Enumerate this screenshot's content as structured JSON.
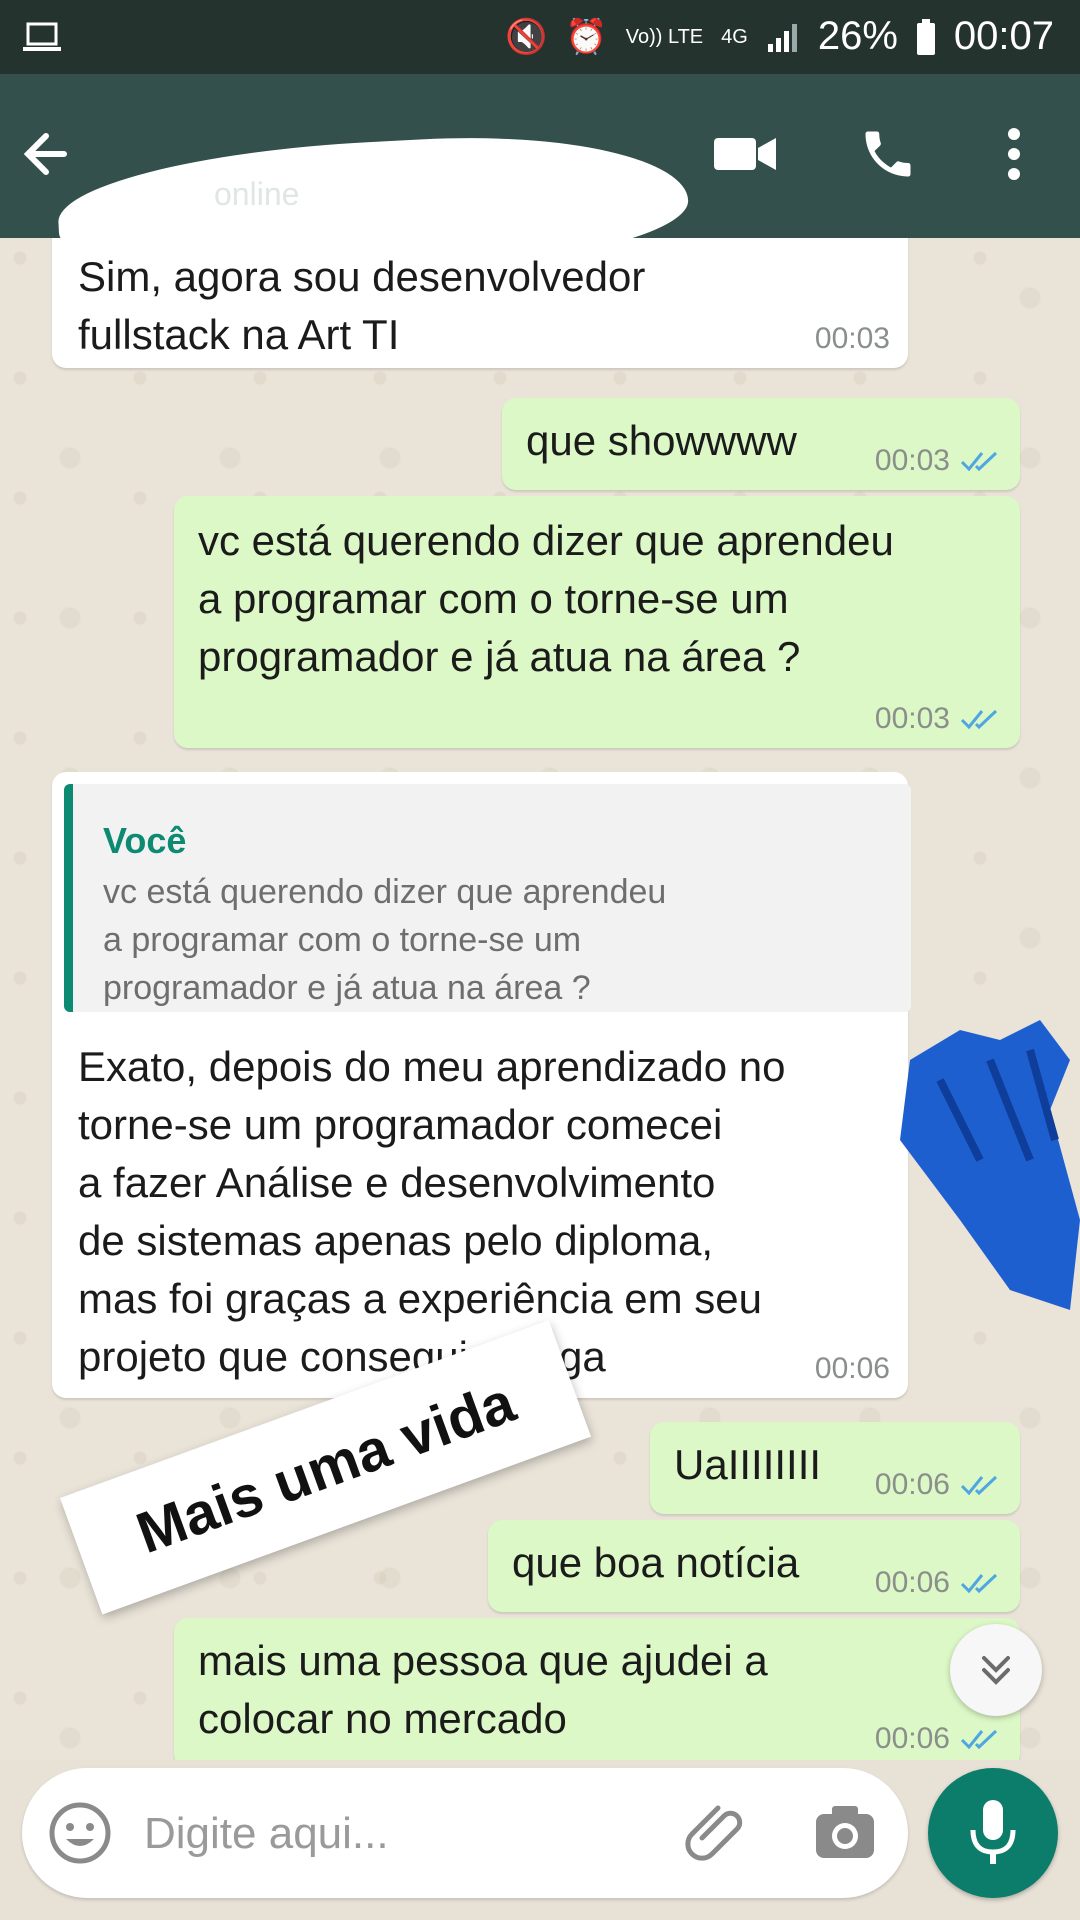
{
  "status_bar": {
    "battery": "26%",
    "time": "00:07",
    "network": "4G",
    "volte": "Vo)) LTE"
  },
  "header": {
    "contact_status": "online",
    "icons": [
      "back-arrow-icon",
      "video-call-icon",
      "phone-icon",
      "more-vert-icon"
    ]
  },
  "messages": [
    {
      "direction": "in",
      "text": "Sim, agora sou desenvolvedor\nfullstack na Art TI",
      "time": "00:03"
    },
    {
      "direction": "out",
      "text": "que showwww",
      "time": "00:03"
    },
    {
      "direction": "out",
      "text": "vc está querendo dizer que aprendeu\na programar com o torne-se um\nprogramador e já atua na área ?",
      "time": "00:03"
    },
    {
      "direction": "in",
      "quote_author": "Você",
      "quote_text": "vc está querendo dizer que aprendeu\na programar com o torne-se um\nprogramador e já atua na área ?",
      "text": "Exato, depois do meu aprendizado no\ntorne-se um programador comecei\na fazer Análise e desenvolvimento\nde sistemas apenas pelo diploma,\nmas foi graças a experiência em seu\nprojeto que consegui a vaga",
      "time": "00:06"
    },
    {
      "direction": "out",
      "text": "UaIIIIIIII",
      "time": "00:06"
    },
    {
      "direction": "out",
      "text": "que boa notícia",
      "time": "00:06"
    },
    {
      "direction": "out",
      "text": "mais uma pessoa que ajudei a\ncolocar no mercado",
      "time": "00:06"
    }
  ],
  "sticker_text": "Mais uma vida",
  "composer": {
    "placeholder": "Digite aqui..."
  },
  "colors": {
    "header": "#33504c",
    "status_bar": "#25332f",
    "outgoing_bubble": "#dcf8c6",
    "incoming_bubble": "#ffffff",
    "accent": "#0d7d6b",
    "read_ticks": "#4fa6e0"
  }
}
